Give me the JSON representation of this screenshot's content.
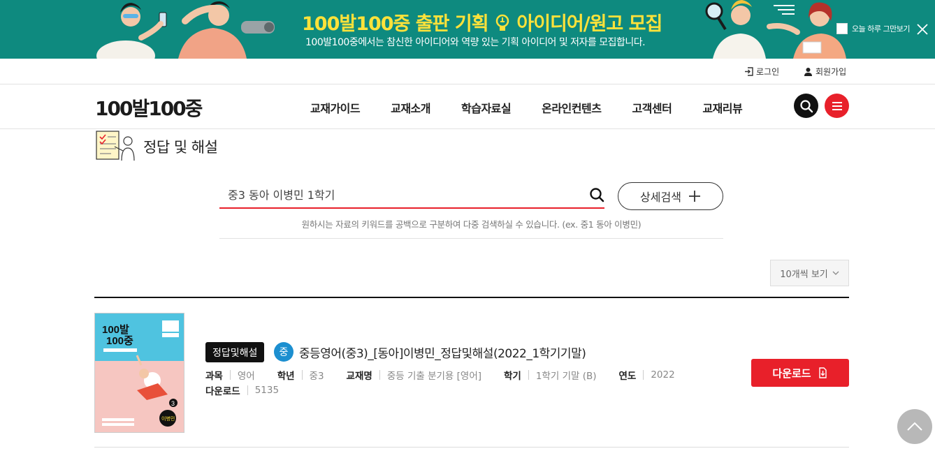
{
  "banner": {
    "title_part1": "100발100중 출판 기획",
    "title_part2": "아이디어/원고 모집",
    "subtitle": "100발100중에서는 참신한 아이디어와 역량 있는 기획 아이디어 및 저자를 모집합니다.",
    "hide_today_label": "오늘 하루 그만보기",
    "close_icon": "close-icon",
    "colors": {
      "background": "#0e8a7f",
      "title": "#ffe23a"
    }
  },
  "util": {
    "login_label": "로그인",
    "signup_label": "회원가입"
  },
  "header": {
    "logo_parts": [
      "100",
      "발",
      "100",
      "중"
    ],
    "nav": [
      "교재가이드",
      "교재소개",
      "학습자료실",
      "온라인컨텐츠",
      "고객센터",
      "교재리뷰"
    ],
    "search_icon": "search-icon",
    "menu_icon": "hamburger-icon"
  },
  "page": {
    "title": "정답 및 해설"
  },
  "search": {
    "value": "중3 동아 이병민 1학기",
    "advanced_label": "상세검색",
    "hint": "원하시는 자료의 키워드를 공백으로 구분하여 다중 검색하실 수 있습니다. (ex. 중1 동아 이병민)"
  },
  "list": {
    "per_page_label": "10개씩 보기",
    "items": [
      {
        "badge": "정답및해설",
        "level": "중",
        "title": "중등영어(중3)_[동아]이병민_정답및해설(2022_1학기기말)",
        "meta": [
          {
            "key": "과목",
            "value": "영어"
          },
          {
            "key": "학년",
            "value": "중3"
          },
          {
            "key": "교재명",
            "value": "중등 기출 분기용 [영어]"
          },
          {
            "key": "학기",
            "value": "1학기 기말 (B)"
          },
          {
            "key": "연도",
            "value": "2022"
          }
        ],
        "downloads_key": "다운로드",
        "downloads_value": "5135",
        "download_label": "다운로드",
        "cover": {
          "logo_top": "100발",
          "logo_bottom": "100중",
          "grade_badge": "3",
          "author": "이병민"
        }
      }
    ]
  },
  "colors": {
    "accent": "#e8202a",
    "level_badge": "#1c8fd0"
  }
}
